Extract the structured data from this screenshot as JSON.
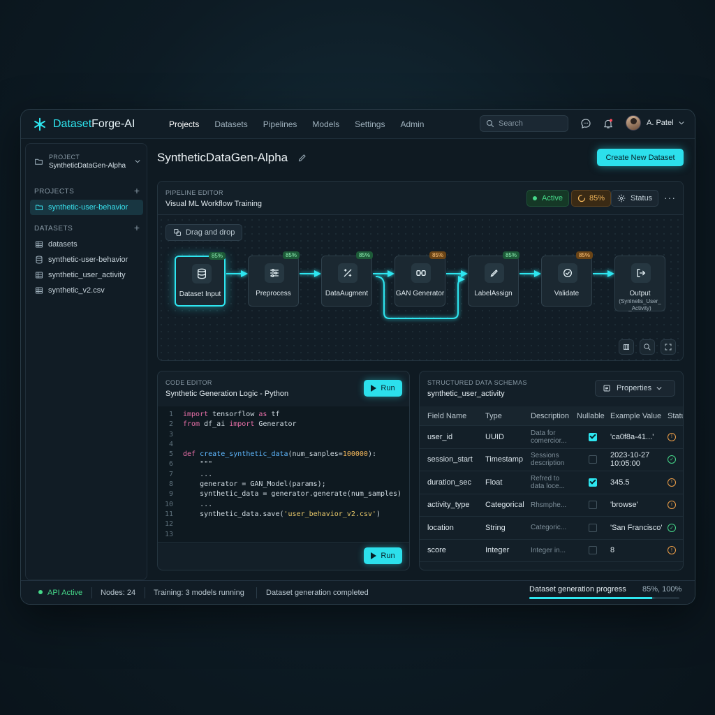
{
  "app": {
    "brand_prefix": "Dataset",
    "brand_suffix": "Forge-AI"
  },
  "nav": [
    "Projects",
    "Datasets",
    "Pipelines",
    "Models",
    "Settings",
    "Admin"
  ],
  "search": {
    "placeholder": "Search"
  },
  "user": {
    "name": "A. Patel"
  },
  "sidebar": {
    "project_label": "PROJECT",
    "project_name": "SyntheticDataGen-Alpha",
    "projects_header": "PROJECTS",
    "projects": [
      "synthetic-user-behavior"
    ],
    "datasets_header": "DATASETS",
    "datasets": [
      "datasets",
      "synthetic-user-behavior",
      "synthetic_user_activity",
      "synthetic_v2.csv"
    ]
  },
  "page": {
    "title": "SyntheticDataGen-Alpha",
    "create_label": "Create New Dataset"
  },
  "pipeline": {
    "small_label": "PIPELINE EDITOR",
    "title": "Visual ML Workflow Training",
    "active_label": "Active",
    "progress_label": "85%",
    "status_label": "Status",
    "more_label": "···",
    "drag_label": "Drag and drop",
    "nodes": [
      {
        "label": "Dataset Input",
        "pct": "85%",
        "pct_color": "green",
        "icon": "database-icon",
        "selected": true
      },
      {
        "label": "Preprocess",
        "pct": "85%",
        "pct_color": "green",
        "icon": "sliders-icon"
      },
      {
        "label": "DataAugment",
        "pct": "85%",
        "pct_color": "green",
        "icon": "sparkle-icon"
      },
      {
        "label": "GAN Generator",
        "pct": "85%",
        "pct_color": "orange",
        "icon": "gan-icon"
      },
      {
        "label": "LabelAssign",
        "pct": "85%",
        "pct_color": "green",
        "icon": "pen-icon"
      },
      {
        "label": "Validate",
        "pct": "85%",
        "pct_color": "orange",
        "icon": "check-circle-icon"
      },
      {
        "label": "Output",
        "sub": "(Synlnelis_User_ _Activity)",
        "icon": "export-icon"
      }
    ]
  },
  "code": {
    "small_label": "CODE EDITOR",
    "title": "Synthetic Generation Logic - Python",
    "run_label": "Run",
    "lines": [
      [
        [
          "kw",
          "import"
        ],
        [
          "txt",
          " tensorflow "
        ],
        [
          "kw",
          "as"
        ],
        [
          "txt",
          " tf"
        ]
      ],
      [
        [
          "kw",
          "from"
        ],
        [
          "txt",
          " df_ai "
        ],
        [
          "kw",
          "import"
        ],
        [
          "txt",
          " Generator"
        ]
      ],
      [],
      [],
      [
        [
          "kw",
          "def"
        ],
        [
          "txt",
          " "
        ],
        [
          "fn",
          "create_synthetic_data"
        ],
        [
          "txt",
          "(num_sanples="
        ],
        [
          "num",
          "100000"
        ],
        [
          "txt",
          "):"
        ]
      ],
      [
        [
          "txt",
          "    \"\"\""
        ]
      ],
      [
        [
          "txt",
          "    ..."
        ]
      ],
      [
        [
          "txt",
          "    generator = GAN_Model(params);"
        ]
      ],
      [
        [
          "txt",
          "    synthetic_data = generator.generate(num_samples)"
        ]
      ],
      [
        [
          "txt",
          "    ..."
        ]
      ],
      [
        [
          "txt",
          "    synthetic_data.save("
        ],
        [
          "str",
          "'user_behavior_v2.csv'"
        ],
        [
          "txt",
          ")"
        ]
      ],
      [],
      []
    ]
  },
  "schema": {
    "small_label": "STRUCTURED DATA SCHEMAS",
    "title": "synthetic_user_activity",
    "properties_label": "Properties",
    "headers": [
      "Field Name",
      "Type",
      "Description",
      "Nullable",
      "Example Value",
      "Status"
    ],
    "rows": [
      {
        "field": "user_id",
        "type": "UUID",
        "desc": "Data for comercior...",
        "nullable": true,
        "example": "'ca0f8a-41...'",
        "status": "warn"
      },
      {
        "field": "session_start",
        "type": "Timestamp",
        "desc": "Sessions description",
        "nullable": false,
        "example": "2023-10-27 10:05:00",
        "status": "ok"
      },
      {
        "field": "duration_sec",
        "type": "Float",
        "desc": "Refred to data loce...",
        "nullable": true,
        "example": "345.5",
        "status": "warn"
      },
      {
        "field": "activity_type",
        "type": "Categorical",
        "desc": "Rhsmphe...",
        "nullable": false,
        "example": "'browse'",
        "status": "warn"
      },
      {
        "field": "location",
        "type": "String",
        "desc": "Categoric...",
        "nullable": false,
        "example": "'San Francisco'",
        "status": "ok"
      },
      {
        "field": "score",
        "type": "Integer",
        "desc": "Integer in...",
        "nullable": false,
        "example": "8",
        "status": "warn"
      }
    ]
  },
  "statusbar": {
    "api": "API Active",
    "nodes": "Nodes: 24",
    "training": "Training: 3 models running",
    "message": "Dataset generation completed",
    "progress_label": "Dataset generation progress",
    "progress_value": "85%, 100%",
    "progress_fraction": 0.82
  },
  "colors": {
    "accent": "#2ee6f0",
    "ok": "#46d98a",
    "warn": "#f0a048"
  }
}
